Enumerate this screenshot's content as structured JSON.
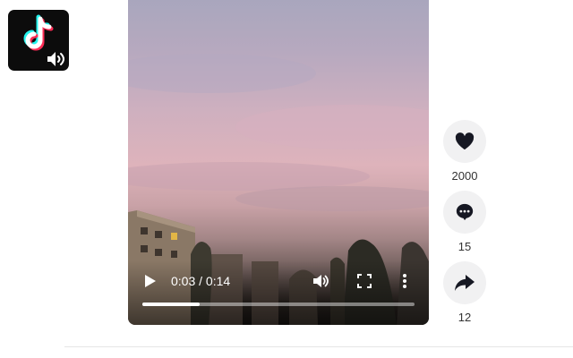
{
  "video": {
    "time_display": "0:03 / 0:14",
    "progress_fraction": 0.21
  },
  "actions": {
    "likes": "2000",
    "comments": "15",
    "shares": "12"
  },
  "icons": {
    "app_logo": "tiktok-logo-icon",
    "sound": "speaker-icon",
    "play": "play-icon",
    "volume": "volume-icon",
    "fullscreen": "fullscreen-icon",
    "more": "more-vertical-icon",
    "like": "heart-icon",
    "comment": "comment-icon",
    "share": "share-arrow-icon"
  },
  "colors": {
    "badge_background": "#0c0c0c",
    "logo_cyan": "#25f4ee",
    "logo_red": "#fe2c55",
    "action_circle": "#f1f1f2"
  }
}
